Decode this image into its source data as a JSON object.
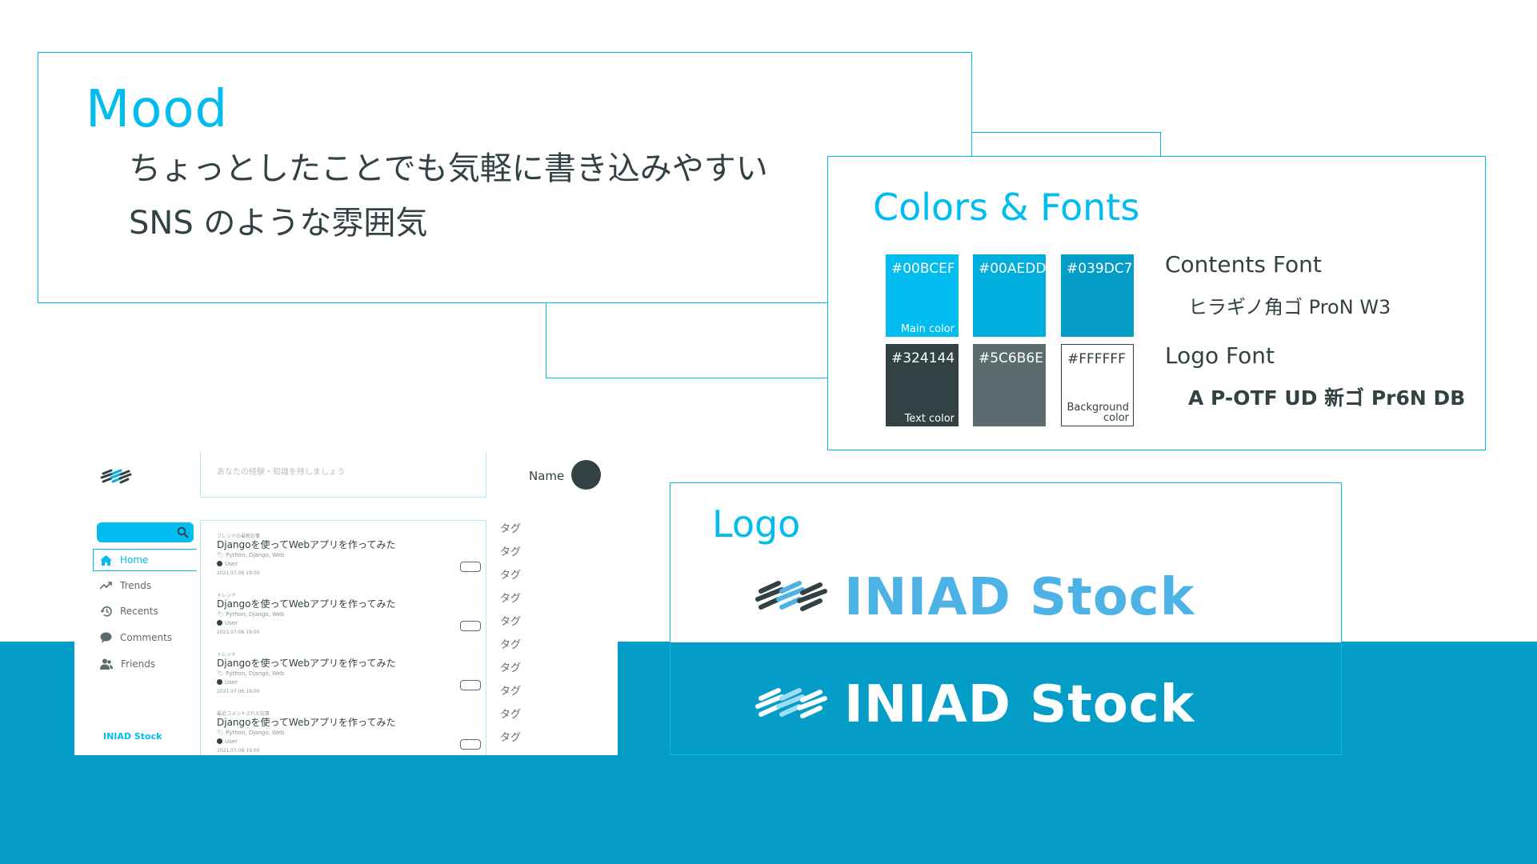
{
  "mood": {
    "title": "Mood",
    "line1": "ちょっとしたことでも気軽に書き込みやすい",
    "line2": "SNS のような雰囲気"
  },
  "colors_fonts": {
    "title": "Colors & Fonts",
    "swatches": [
      {
        "hex": "#00BCEF",
        "role": "Main color"
      },
      {
        "hex": "#00AEDD",
        "role": ""
      },
      {
        "hex": "#039DC7",
        "role": ""
      },
      {
        "hex": "#324144",
        "role": "Text color"
      },
      {
        "hex": "#5C6B6E",
        "role": ""
      },
      {
        "hex": "#FFFFFF",
        "role_line1": "Background",
        "role_line2": "color"
      }
    ],
    "contents_font_label": "Contents Font",
    "contents_font_value": "ヒラギノ角ゴ ProN W3",
    "logo_font_label": "Logo Font",
    "logo_font_value": "A P-OTF UD 新ゴ Pr6N DB"
  },
  "logo": {
    "title": "Logo",
    "wordmark": "INIAD Stock",
    "wordmark_color_on_white": "#4DB3E6",
    "wordmark_color_on_blue": "#FFFFFF"
  },
  "app": {
    "compose_placeholder": "あなたの経験・知識を残しましょう",
    "user_name": "Name",
    "nav": [
      {
        "label": "Home",
        "icon": "home-icon"
      },
      {
        "label": "Trends",
        "icon": "trending-icon"
      },
      {
        "label": "Recents",
        "icon": "history-icon"
      },
      {
        "label": "Comments",
        "icon": "comment-icon"
      },
      {
        "label": "Friends",
        "icon": "friends-icon"
      }
    ],
    "brand": "INIAD Stock",
    "posts": [
      {
        "kind": "フレンドの最新記事",
        "title": "Djangoを使ってWebアプリを作ってみた",
        "tags": "Python, Django, Web",
        "user": "User",
        "date": "2021.07.06 19:00"
      },
      {
        "kind": "トレンド",
        "title": "Djangoを使ってWebアプリを作ってみた",
        "tags": "Python, Django, Web",
        "user": "User",
        "date": "2021.07.06 19:00"
      },
      {
        "kind": "トレンド",
        "title": "Djangoを使ってWebアプリを作ってみた",
        "tags": "Python, Django, Web",
        "user": "User",
        "date": "2021.07.06 19:00"
      },
      {
        "kind": "最近コメントされた記事",
        "title": "Djangoを使ってWebアプリを作ってみた",
        "tags": "Python, Django, Web",
        "user": "User",
        "date": "2021.07.06 19:00"
      }
    ],
    "tags": [
      "タグ",
      "タグ",
      "タグ",
      "タグ",
      "タグ",
      "タグ",
      "タグ",
      "タグ",
      "タグ",
      "タグ"
    ]
  }
}
